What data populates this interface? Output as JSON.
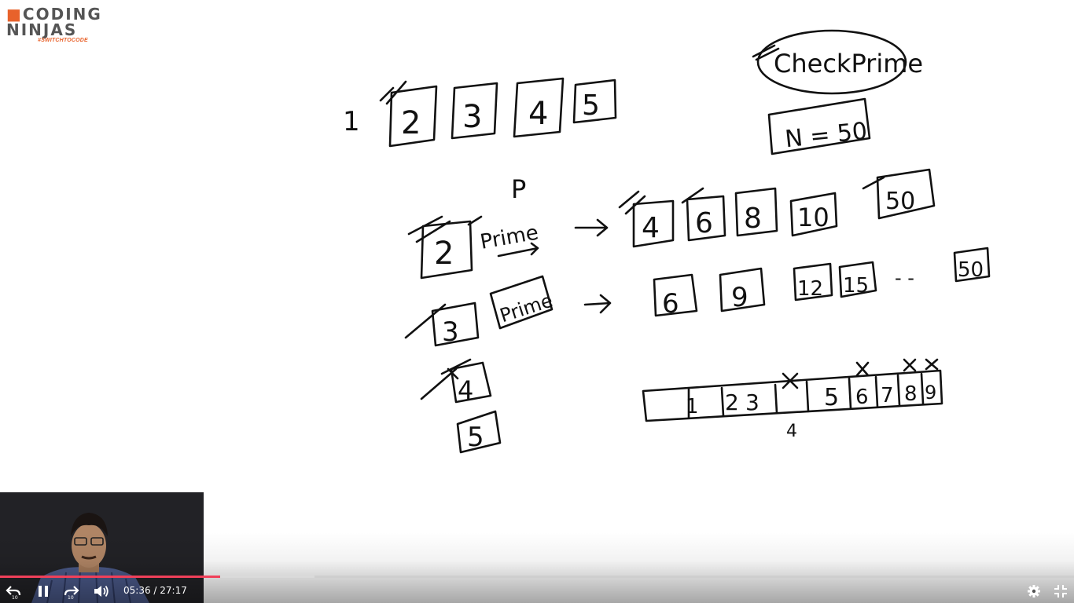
{
  "logo": {
    "top": "CODING",
    "bottom": "NINJAS",
    "tagline": "#SWITCHTOCODE"
  },
  "board": {
    "title": "CheckPrime",
    "limit": "N = 50",
    "top_row": [
      "1",
      "2",
      "3",
      "4",
      "5"
    ],
    "p_label": "P",
    "row_two": {
      "start": "2",
      "tag": "Prime",
      "multiples": [
        "4",
        "6",
        "8",
        "10",
        "50"
      ]
    },
    "row_three": {
      "start": "3",
      "tag": "Prime",
      "multiples": [
        "6",
        "9",
        "12",
        "15",
        "- -",
        "50"
      ]
    },
    "row_four": {
      "start": "4"
    },
    "row_five": {
      "start": "5"
    },
    "array": [
      "1",
      "2",
      "3",
      "",
      "5",
      "6",
      "7",
      "8",
      "9"
    ],
    "array_note": "4"
  },
  "player": {
    "current_time": "05:36",
    "duration": "27:17",
    "separator": " / ",
    "progress_fraction": 0.205,
    "buffered_fraction": 0.293,
    "accent": "#f0405a",
    "buttons": {
      "rewind": "rewind-icon",
      "pause": "pause-icon",
      "forward": "forward-icon",
      "volume": "volume-icon",
      "settings": "gear-icon",
      "exit_fullscreen": "exit-fullscreen-icon"
    },
    "skip_seconds": "10"
  }
}
